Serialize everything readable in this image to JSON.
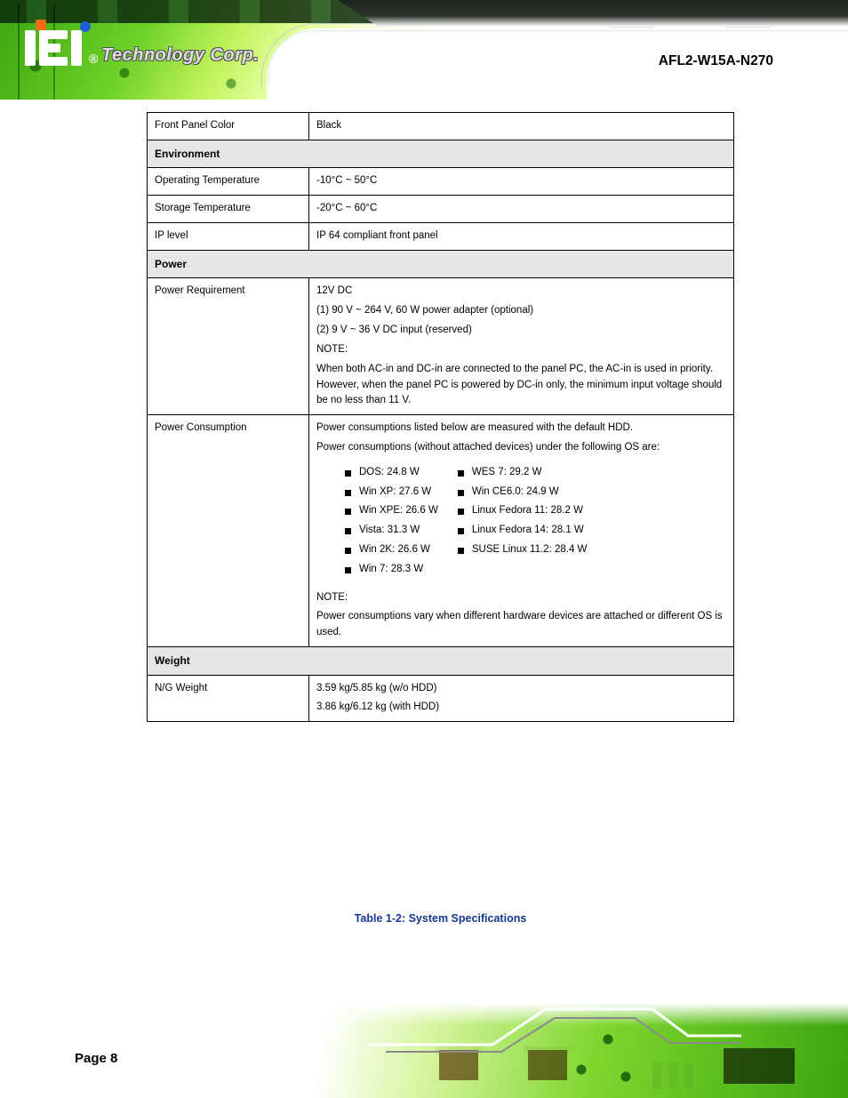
{
  "header": {
    "logo_text": "Technology Corp.",
    "reg_mark": "®",
    "title": "AFL2-W15A-N270"
  },
  "table": {
    "rows": [
      {
        "label": "Front Panel Color",
        "value": "Black"
      }
    ],
    "section_env": "Environment",
    "env_rows": [
      {
        "label": "Operating Temperature",
        "value": "-10°C ~ 50°C"
      },
      {
        "label": "Storage Temperature",
        "value": "-20°C ~ 60°C"
      },
      {
        "label": "IP level",
        "value": "IP 64 compliant front panel"
      }
    ],
    "section_power": "Power",
    "power_requirement": {
      "label": "Power Requirement",
      "lines": [
        "12V DC",
        "(1) 90 V ~ 264 V, 60 W power adapter (optional)",
        "(2) 9 V ~ 36 V DC input (reserved)",
        "NOTE:",
        "When both AC-in and DC-in are connected to the panel PC, the AC-in is used in priority. However, when the panel PC is powered by DC-in only, the minimum input voltage should be no less than 11 V."
      ]
    },
    "power_consumption": {
      "label": "Power Consumption",
      "intro_lines": [
        "Power consumptions listed below are measured with the default HDD.",
        "Power consumptions (without attached devices) under the following OS are:"
      ],
      "os_list_col1": [
        "DOS: 24.8 W",
        "Win XP: 27.6 W",
        "Win XPE: 26.6 W",
        "Vista: 31.3 W",
        "Win 2K: 26.6 W",
        "Win 7: 28.3 W"
      ],
      "os_list_col2": [
        "WES 7: 29.2 W",
        "Win CE6.0: 24.9 W",
        "Linux Fedora 11: 28.2 W",
        "Linux Fedora 14: 28.1 W",
        "SUSE Linux 11.2: 28.4 W"
      ],
      "note_lines": [
        "NOTE:",
        "Power consumptions vary when different hardware devices are attached or different OS is used."
      ]
    },
    "section_weight": "Weight",
    "weight_row": {
      "label": "N/G Weight",
      "lines": [
        "3.59 kg/5.85 kg (w/o HDD)",
        "3.86 kg/6.12 kg (with HDD)"
      ]
    }
  },
  "caption": "Table 1-2: System Specifications",
  "footer": {
    "page": "Page 8"
  }
}
